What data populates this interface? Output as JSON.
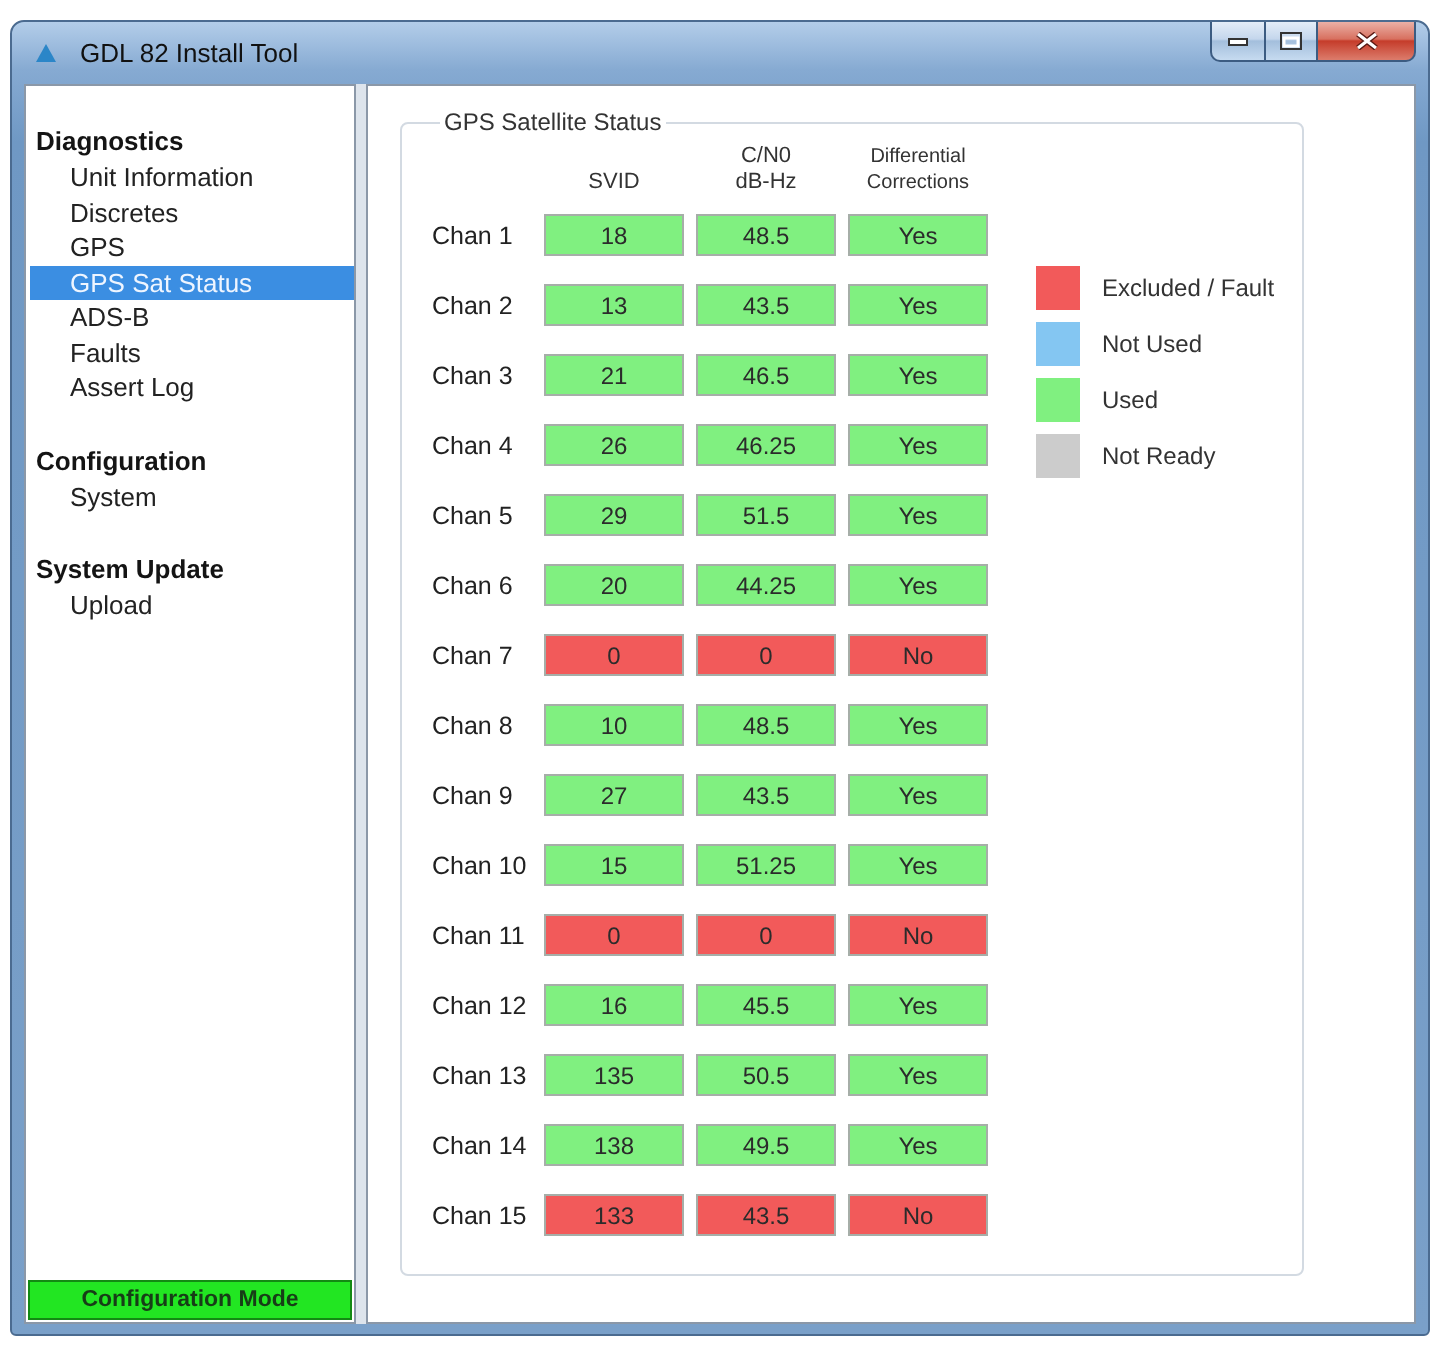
{
  "window": {
    "title": "GDL 82 Install Tool"
  },
  "sidebar": {
    "sections": [
      {
        "title": "Diagnostics",
        "items": [
          {
            "label": "Unit Information",
            "selected": false
          },
          {
            "label": "Discretes",
            "selected": false
          },
          {
            "label": "GPS",
            "selected": false
          },
          {
            "label": "GPS Sat Status",
            "selected": true
          },
          {
            "label": "ADS-B",
            "selected": false
          },
          {
            "label": "Faults",
            "selected": false
          },
          {
            "label": "Assert Log",
            "selected": false
          }
        ]
      },
      {
        "title": "Configuration",
        "items": [
          {
            "label": "System",
            "selected": false
          }
        ]
      },
      {
        "title": "System Update",
        "items": [
          {
            "label": "Upload",
            "selected": false
          }
        ]
      }
    ]
  },
  "status_bar": {
    "text": "Configuration Mode"
  },
  "panel": {
    "title": "GPS Satellite Status",
    "columns": [
      "SVID",
      "C/N0\ndB-Hz",
      "Differential\nCorrections"
    ],
    "rows": [
      {
        "label": "Chan 1",
        "color": "#80f080",
        "cells": [
          "18",
          "48.5",
          "Yes"
        ]
      },
      {
        "label": "Chan 2",
        "color": "#80f080",
        "cells": [
          "13",
          "43.5",
          "Yes"
        ]
      },
      {
        "label": "Chan 3",
        "color": "#80f080",
        "cells": [
          "21",
          "46.5",
          "Yes"
        ]
      },
      {
        "label": "Chan 4",
        "color": "#80f080",
        "cells": [
          "26",
          "46.25",
          "Yes"
        ]
      },
      {
        "label": "Chan 5",
        "color": "#80f080",
        "cells": [
          "29",
          "51.5",
          "Yes"
        ]
      },
      {
        "label": "Chan 6",
        "color": "#80f080",
        "cells": [
          "20",
          "44.25",
          "Yes"
        ]
      },
      {
        "label": "Chan 7",
        "color": "#f25a5a",
        "cells": [
          "0",
          "0",
          "No"
        ]
      },
      {
        "label": "Chan 8",
        "color": "#80f080",
        "cells": [
          "10",
          "48.5",
          "Yes"
        ]
      },
      {
        "label": "Chan 9",
        "color": "#80f080",
        "cells": [
          "27",
          "43.5",
          "Yes"
        ]
      },
      {
        "label": "Chan 10",
        "color": "#80f080",
        "cells": [
          "15",
          "51.25",
          "Yes"
        ]
      },
      {
        "label": "Chan 11",
        "color": "#f25a5a",
        "cells": [
          "0",
          "0",
          "No"
        ]
      },
      {
        "label": "Chan 12",
        "color": "#80f080",
        "cells": [
          "16",
          "45.5",
          "Yes"
        ]
      },
      {
        "label": "Chan 13",
        "color": "#80f080",
        "cells": [
          "135",
          "50.5",
          "Yes"
        ]
      },
      {
        "label": "Chan 14",
        "color": "#80f080",
        "cells": [
          "138",
          "49.5",
          "Yes"
        ]
      },
      {
        "label": "Chan 15",
        "color": "#f25a5a",
        "cells": [
          "133",
          "43.5",
          "No"
        ]
      }
    ],
    "legend": [
      {
        "label": "Excluded / Fault",
        "color": "#f25a5a"
      },
      {
        "label": "Not Used",
        "color": "#84c6f2"
      },
      {
        "label": "Used",
        "color": "#80f080"
      },
      {
        "label": "Not Ready",
        "color": "#cccccc"
      }
    ]
  }
}
